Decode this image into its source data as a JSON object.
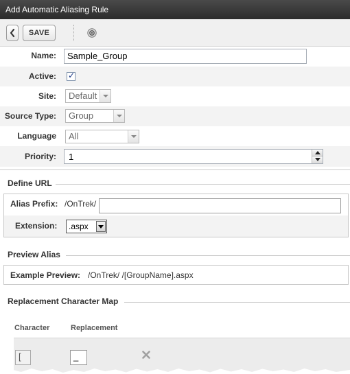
{
  "window": {
    "title": "Add Automatic Aliasing Rule"
  },
  "toolbar": {
    "save_label": "SAVE",
    "back_icon": "chevron-left-icon",
    "help_icon": "help-icon"
  },
  "form": {
    "name": {
      "label": "Name:",
      "value": "Sample_Group"
    },
    "active": {
      "label": "Active:",
      "checked": true
    },
    "site": {
      "label": "Site:",
      "value": "Default"
    },
    "source_type": {
      "label": "Source Type:",
      "value": "Group"
    },
    "language": {
      "label": "Language",
      "value": "All"
    },
    "priority": {
      "label": "Priority:",
      "value": "1"
    }
  },
  "define_url": {
    "title": "Define URL",
    "alias_prefix": {
      "label": "Alias Prefix:",
      "prefix": "/OnTrek/",
      "value": ""
    },
    "extension": {
      "label": "Extension:",
      "value": ".aspx"
    }
  },
  "preview": {
    "title": "Preview Alias",
    "label": "Example Preview:",
    "value": "/OnTrek/ /[GroupName].aspx"
  },
  "char_map": {
    "title": "Replacement Character Map",
    "headers": {
      "character": "Character",
      "replacement": "Replacement"
    },
    "rows": [
      {
        "character": "[",
        "replacement": "_"
      }
    ]
  },
  "colors": {
    "titlebar": "#333333",
    "toolbar": "#f0f0f0",
    "row_alt": "#f3f3f3",
    "delete_icon": "#a0a0a0"
  }
}
